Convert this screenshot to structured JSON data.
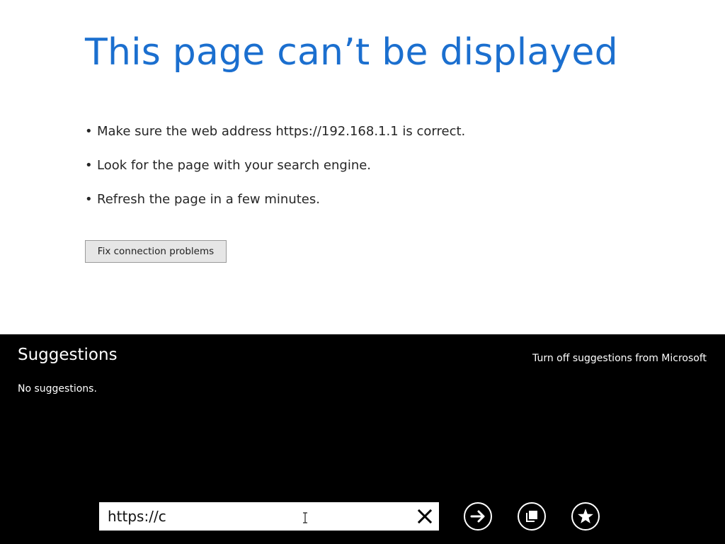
{
  "error_page": {
    "title": "This page can’t be displayed",
    "tips": [
      "Make sure the web address https://192.168.1.1 is correct.",
      "Look for the page with your search engine.",
      "Refresh the page in a few minutes."
    ],
    "bullet": "•",
    "fix_button_label": "Fix connection problems",
    "title_color": "#1b6fcf"
  },
  "app_bar": {
    "suggestions_title": "Suggestions",
    "turn_off_label": "Turn off suggestions from Microsoft",
    "no_suggestions_text": "No suggestions.",
    "background_color": "#000000",
    "address": {
      "value": "https://c",
      "clear_icon": "close-icon"
    },
    "buttons": {
      "go_icon": "arrow-right-circle-icon",
      "tabs_icon": "tabs-icon",
      "favorite_icon": "star-icon"
    }
  }
}
